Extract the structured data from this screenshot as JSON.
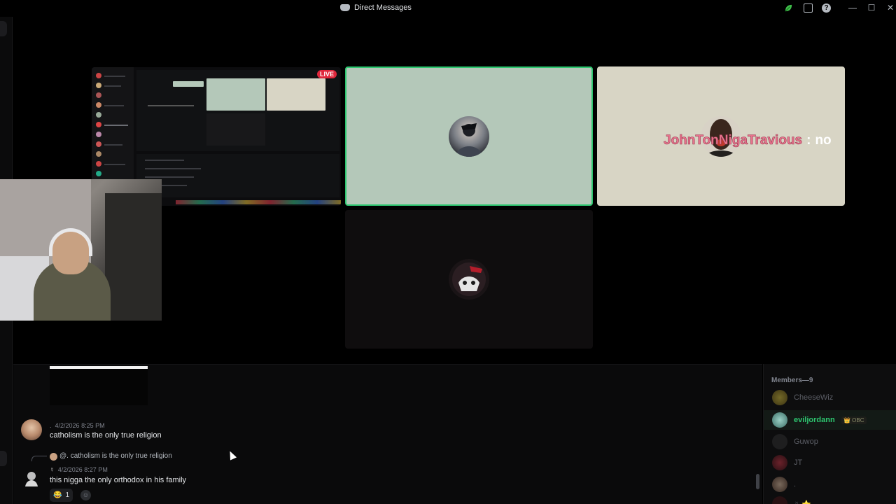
{
  "window": {
    "title": "Direct Messages",
    "controls": [
      "—",
      "☐",
      "✕"
    ]
  },
  "stage": {
    "live_badge": "LIVE",
    "overlay_name": "JohnTonNigaTravious",
    "overlay_separator": ":",
    "overlay_message": "no"
  },
  "chat": {
    "messages": [
      {
        "author_dot": ".",
        "timestamp": "4/2/2026 8:25 PM",
        "text": "catholism is the only true religion"
      },
      {
        "reply_to": "@. catholism is the only true religion",
        "author_symbol": "☿",
        "timestamp": "4/2/2026 8:27 PM",
        "text": "this nigga the only orthodox in his family",
        "reaction_emoji": "😂",
        "reaction_count": "1",
        "add_reaction": "☺"
      }
    ]
  },
  "members": {
    "header": "Members—9",
    "list": [
      {
        "name": "CheeseWiz",
        "color": "#5c5e66"
      },
      {
        "name": "eviljordann",
        "tag": "👑 OBC",
        "color": "#2dc770"
      },
      {
        "name": "Guwop",
        "color": "#5c5e66"
      },
      {
        "name": "JT",
        "color": "#5c5e66"
      },
      {
        "name": ".",
        "color": "#5c5e66"
      },
      {
        "name": "☿ ⭐",
        "color": "#5c5e66"
      }
    ]
  },
  "icons": {
    "leaf": "leaf-icon",
    "inbox": "inbox-icon",
    "help": "help-icon"
  }
}
